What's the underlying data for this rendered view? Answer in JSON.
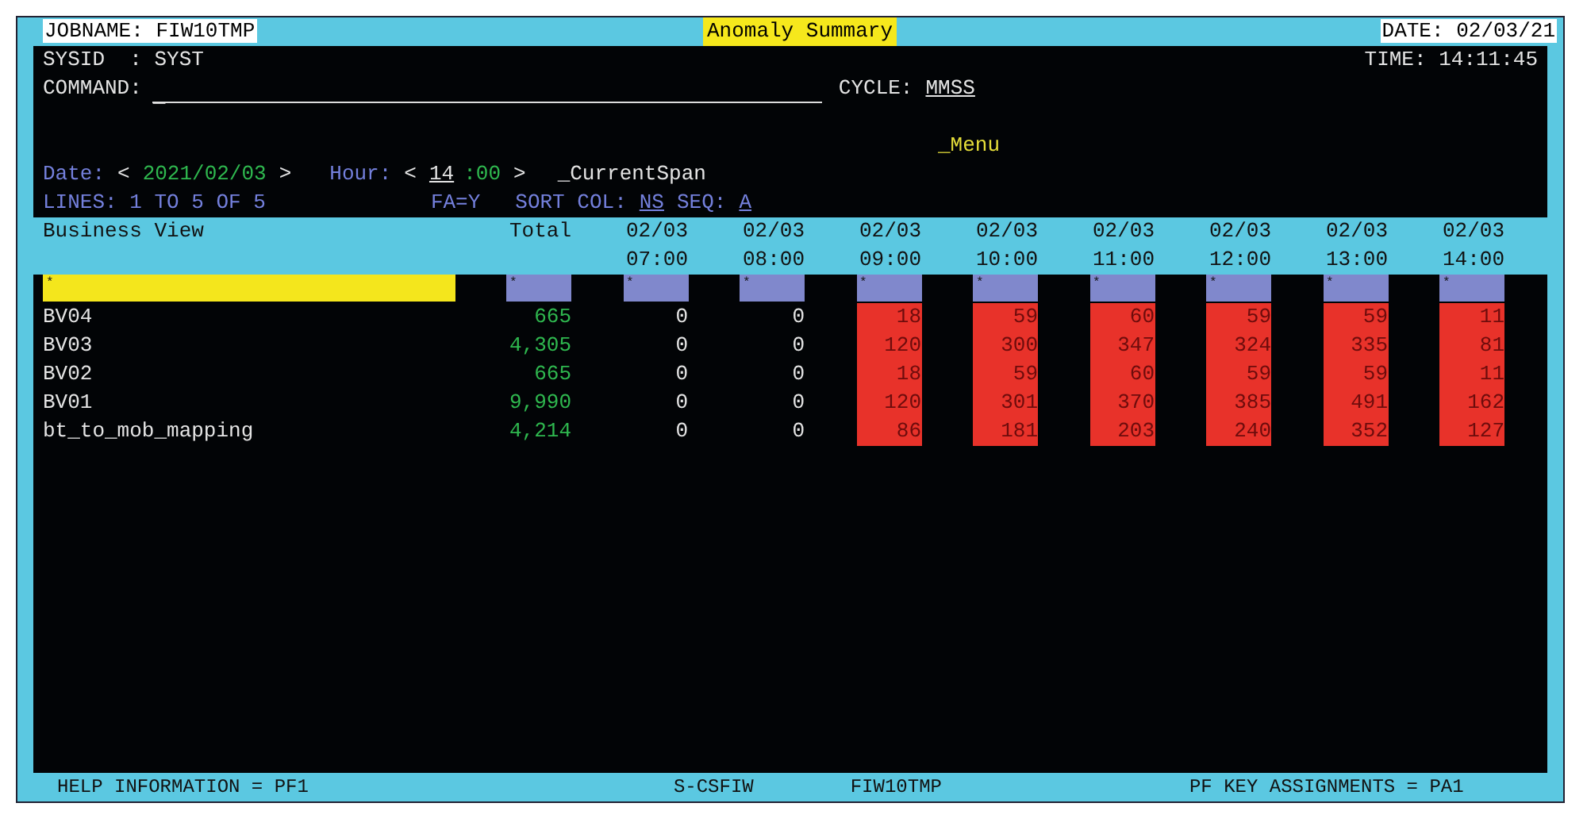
{
  "top_bar": {
    "jobname": "JOBNAME: FIW10TMP",
    "title": "Anomaly Summary",
    "date": "DATE: 02/03/21"
  },
  "sysid": "SYSID  : SYST",
  "time": "TIME: 14:11:45",
  "command": {
    "label": "COMMAND:",
    "cursor": "_"
  },
  "cycle": {
    "label": "CYCLE:",
    "value": "MMSS"
  },
  "menu": "_Menu",
  "date_nav": {
    "label": "Date:",
    "prev": "<",
    "value": "2021/02/03",
    "next": ">"
  },
  "hour_nav": {
    "label": "Hour:",
    "prev": "<",
    "value": "14",
    "suffix": ":00",
    "next": ">"
  },
  "current_span": "_CurrentSpan",
  "lines": "LINES: 1 TO 5 OF 5",
  "fa": "FA=Y",
  "sort": {
    "label": "SORT COL:",
    "value": "NS",
    "seq_label": "SEQ:",
    "seq_value": "A"
  },
  "table": {
    "columns": [
      {
        "line1": "Business View"
      },
      {
        "line1": "Total"
      },
      {
        "line1": "02/03",
        "line2": "07:00"
      },
      {
        "line1": "02/03",
        "line2": "08:00"
      },
      {
        "line1": "02/03",
        "line2": "09:00"
      },
      {
        "line1": "02/03",
        "line2": "10:00"
      },
      {
        "line1": "02/03",
        "line2": "11:00"
      },
      {
        "line1": "02/03",
        "line2": "12:00"
      },
      {
        "line1": "02/03",
        "line2": "13:00"
      },
      {
        "line1": "02/03",
        "line2": "14:00"
      }
    ],
    "filters": [
      "*",
      "*",
      "*",
      "*",
      "*",
      "*",
      "*",
      "*",
      "*",
      "*"
    ],
    "rows": [
      {
        "cells": [
          {
            "kind": "name",
            "value": "BV04"
          },
          {
            "kind": "total",
            "value": "665"
          },
          {
            "kind": "count",
            "value": "0",
            "alert": false
          },
          {
            "kind": "count",
            "value": "0",
            "alert": false
          },
          {
            "kind": "count",
            "value": "18",
            "alert": true
          },
          {
            "kind": "count",
            "value": "59",
            "alert": true
          },
          {
            "kind": "count",
            "value": "60",
            "alert": true
          },
          {
            "kind": "count",
            "value": "59",
            "alert": true
          },
          {
            "kind": "count",
            "value": "59",
            "alert": true
          },
          {
            "kind": "count",
            "value": "11",
            "alert": true
          }
        ]
      },
      {
        "cells": [
          {
            "kind": "name",
            "value": "BV03"
          },
          {
            "kind": "total",
            "value": "4,305"
          },
          {
            "kind": "count",
            "value": "0",
            "alert": false
          },
          {
            "kind": "count",
            "value": "0",
            "alert": false
          },
          {
            "kind": "count",
            "value": "120",
            "alert": true
          },
          {
            "kind": "count",
            "value": "300",
            "alert": true
          },
          {
            "kind": "count",
            "value": "347",
            "alert": true
          },
          {
            "kind": "count",
            "value": "324",
            "alert": true
          },
          {
            "kind": "count",
            "value": "335",
            "alert": true
          },
          {
            "kind": "count",
            "value": "81",
            "alert": true
          }
        ]
      },
      {
        "cells": [
          {
            "kind": "name",
            "value": "BV02"
          },
          {
            "kind": "total",
            "value": "665"
          },
          {
            "kind": "count",
            "value": "0",
            "alert": false
          },
          {
            "kind": "count",
            "value": "0",
            "alert": false
          },
          {
            "kind": "count",
            "value": "18",
            "alert": true
          },
          {
            "kind": "count",
            "value": "59",
            "alert": true
          },
          {
            "kind": "count",
            "value": "60",
            "alert": true
          },
          {
            "kind": "count",
            "value": "59",
            "alert": true
          },
          {
            "kind": "count",
            "value": "59",
            "alert": true
          },
          {
            "kind": "count",
            "value": "11",
            "alert": true
          }
        ]
      },
      {
        "cells": [
          {
            "kind": "name",
            "value": "BV01"
          },
          {
            "kind": "total",
            "value": "9,990"
          },
          {
            "kind": "count",
            "value": "0",
            "alert": false
          },
          {
            "kind": "count",
            "value": "0",
            "alert": false
          },
          {
            "kind": "count",
            "value": "120",
            "alert": true
          },
          {
            "kind": "count",
            "value": "301",
            "alert": true
          },
          {
            "kind": "count",
            "value": "370",
            "alert": true
          },
          {
            "kind": "count",
            "value": "385",
            "alert": true
          },
          {
            "kind": "count",
            "value": "491",
            "alert": true
          },
          {
            "kind": "count",
            "value": "162",
            "alert": true
          }
        ]
      },
      {
        "cells": [
          {
            "kind": "name",
            "value": "bt_to_mob_mapping"
          },
          {
            "kind": "total",
            "value": "4,214"
          },
          {
            "kind": "count",
            "value": "0",
            "alert": false
          },
          {
            "kind": "count",
            "value": "0",
            "alert": false
          },
          {
            "kind": "count",
            "value": "86",
            "alert": true
          },
          {
            "kind": "count",
            "value": "181",
            "alert": true
          },
          {
            "kind": "count",
            "value": "203",
            "alert": true
          },
          {
            "kind": "count",
            "value": "240",
            "alert": true
          },
          {
            "kind": "count",
            "value": "352",
            "alert": true
          },
          {
            "kind": "count",
            "value": "127",
            "alert": true
          }
        ]
      }
    ]
  },
  "footer": [
    "HELP INFORMATION = PF1",
    "S-CSFIW",
    "FIW10TMP",
    "PF KEY ASSIGNMENTS = PA1"
  ]
}
